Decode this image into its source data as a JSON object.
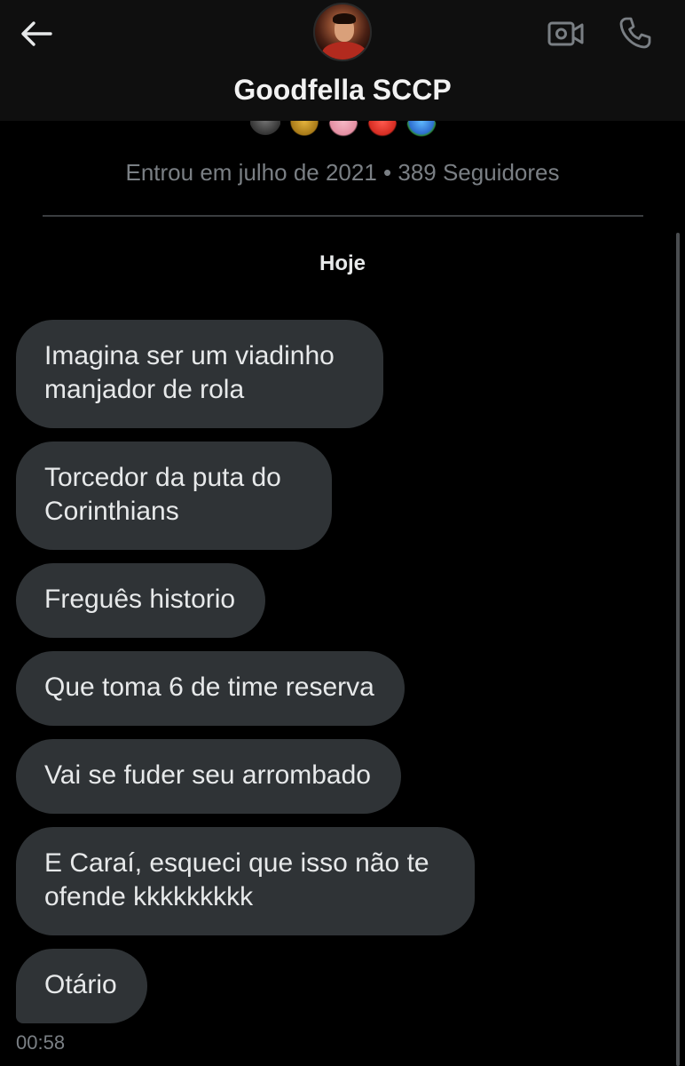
{
  "header": {
    "contact_name": "Goodfella SCCP",
    "back_icon": "arrow-left-icon",
    "video_icon": "video-call-icon",
    "phone_icon": "phone-call-icon"
  },
  "profile": {
    "emojis": [
      "eagle-emoji",
      "trophy-emoji",
      "pig-emoji",
      "no-entry-emoji",
      "globe-emoji"
    ],
    "meta": "Entrou em julho de 2021 • 389 Seguidores"
  },
  "conversation": {
    "day_label": "Hoje",
    "messages": [
      {
        "text": "Imagina ser um viadinho manjador de rola"
      },
      {
        "text": "Torcedor da puta do Corinthians"
      },
      {
        "text": "Freguês historio"
      },
      {
        "text": "Que toma 6 de time reserva"
      },
      {
        "text": "Vai se fuder seu arrombado"
      },
      {
        "text": "E Caraí, esqueci que isso não te ofende kkkkkkkkk"
      },
      {
        "text": "Otário"
      }
    ],
    "last_timestamp": "00:58"
  },
  "colors": {
    "background": "#000000",
    "header": "#0f0f0f",
    "bubble": "#2f3336",
    "text": "#e7e9ea",
    "muted": "#7a7f84"
  }
}
